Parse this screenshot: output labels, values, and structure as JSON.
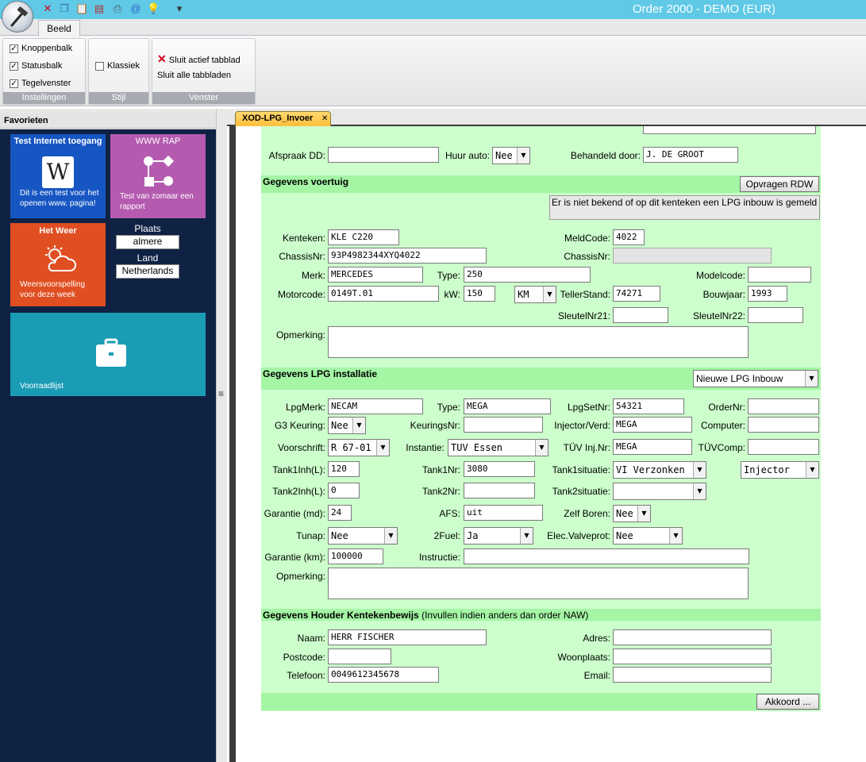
{
  "window": {
    "title": "Order 2000 - DEMO (EUR)"
  },
  "quick_access": [
    {
      "icon": "close-icon",
      "glyph": "✕",
      "color": "#d0021b"
    },
    {
      "icon": "copy-icon",
      "glyph": "❐",
      "color": "#3b6fb5"
    },
    {
      "icon": "paste-icon",
      "glyph": "📋",
      "color": "#3b6fb5"
    },
    {
      "icon": "pdf-icon",
      "glyph": "▤",
      "color": "#b03030"
    },
    {
      "icon": "print-icon",
      "glyph": "⎙",
      "color": "#555555"
    },
    {
      "icon": "email-icon",
      "glyph": "@",
      "color": "#2a62c9"
    },
    {
      "icon": "lightbulb-icon",
      "glyph": "💡",
      "color": "#e0a800"
    },
    {
      "icon": "customize-arrow-icon",
      "glyph": "▾",
      "color": "#333333"
    }
  ],
  "ribbon": {
    "tab": "Beeld",
    "groups": {
      "instellingen": {
        "label": "Instellingen",
        "items": [
          {
            "label": "Knoppenbalk",
            "checked": true
          },
          {
            "label": "Statusbalk",
            "checked": true
          },
          {
            "label": "Tegelvenster",
            "checked": true
          }
        ]
      },
      "stijl": {
        "label": "Stijl",
        "items": [
          {
            "label": "Klassiek",
            "checked": false
          }
        ]
      },
      "venster": {
        "label": "Venster",
        "close_active": "Sluit actief tabblad",
        "close_all": "Sluit alle tabbladen"
      }
    }
  },
  "favorites": {
    "header": "Favorieten",
    "tiles": {
      "internet": {
        "title": "Test Internet toegang",
        "desc": "Dit is een test voor het openen www. pagina!",
        "color": "#1656c2"
      },
      "rap": {
        "title": "WWW RAP",
        "desc": "Test van zomaar een rapport",
        "color": "#b45bb0"
      },
      "weer": {
        "title": "Het Weer",
        "desc": "Weersvoorspelling voor deze week",
        "color": "#e04f22"
      },
      "voorraad": {
        "title": "Voorraadlijst",
        "color": "#1a9cb5"
      }
    },
    "plaats_label": "Plaats",
    "plaats_value": "almere",
    "land_label": "Land",
    "land_value": "Netherlands"
  },
  "doc_tab": {
    "label": "XOD-LPG_Invoer"
  },
  "form": {
    "afspraak_label": "Afspraak DD:",
    "afspraak": "",
    "huurauto_label": "Huur auto:",
    "huurauto": "Nee",
    "behandeld_label": "Behandeld door:",
    "behandeld": "J. DE GROOT",
    "voertuig": {
      "title": "Gegevens voertuig",
      "rdw_button": "Opvragen RDW",
      "notice": "Er is niet bekend of op dit kenteken een LPG inbouw is gemeld",
      "kenteken_label": "Kenteken:",
      "kenteken": "KLE C220",
      "meldcode_label": "MeldCode:",
      "meldcode": "4022",
      "chassis_label": "ChassisNr:",
      "chassis": "93P4982344XYQ4022",
      "chassis2_label": "ChassisNr:",
      "chassis2": "",
      "merk_label": "Merk:",
      "merk": "MERCEDES",
      "type_label": "Type:",
      "type": "250",
      "modelcode_label": "Modelcode:",
      "modelcode": "",
      "motorcode_label": "Motorcode:",
      "motorcode": "0149T.01",
      "kw_label": "kW:",
      "kw": "150",
      "unit": "KM",
      "tellerstand_label": "TellerStand:",
      "tellerstand": "74271",
      "bouwjaar_label": "Bouwjaar:",
      "bouwjaar": "1993",
      "sleutel21_label": "SleutelNr21:",
      "sleutel21": "",
      "sleutel22_label": "SleutelNr22:",
      "sleutel22": "",
      "opmerking_label": "Opmerking:",
      "opmerking": ""
    },
    "lpg": {
      "title": "Gegevens LPG installatie",
      "inbouw_select": "Nieuwe LPG Inbouw",
      "lpgmerk_label": "LpgMerk:",
      "lpgmerk": "NECAM",
      "type_label": "Type:",
      "type": "MEGA",
      "lpgsetnr_label": "LpgSetNr:",
      "lpgsetnr": "54321",
      "ordernr_label": "OrderNr:",
      "ordernr": "",
      "g3_label": "G3 Keuring:",
      "g3": "Nee",
      "keurings_label": "KeuringsNr:",
      "keurings": "",
      "injector_label": "Injector/Verd:",
      "injector": "MEGA",
      "computer_label": "Computer:",
      "computer": "",
      "voorschrift_label": "Voorschrift:",
      "voorschrift": "R 67-01",
      "instantie_label": "Instantie:",
      "instantie": "TUV Essen",
      "tuvinj_label": "TÜV Inj.Nr:",
      "tuvinj": "MEGA",
      "tuvcomp_label": "TÜVComp:",
      "tuvcomp": "",
      "tank1inh_label": "Tank1Inh(L):",
      "tank1inh": "120",
      "tank1nr_label": "Tank1Nr:",
      "tank1nr": "3080",
      "tank1sit_label": "Tank1situatie:",
      "tank1sit": "VI Verzonken",
      "injector_select": "Injector",
      "tank2inh_label": "Tank2Inh(L):",
      "tank2inh": "0",
      "tank2nr_label": "Tank2Nr:",
      "tank2nr": "",
      "tank2sit_label": "Tank2situatie:",
      "tank2sit": "",
      "garantie_md_label": "Garantie (md):",
      "garantie_md": "24",
      "afs_label": "AFS:",
      "afs": "uit",
      "zelfboren_label": "Zelf Boren:",
      "zelfboren": "Nee",
      "tunap_label": "Tunap:",
      "tunap": "Nee",
      "twofuel_label": "2Fuel:",
      "twofuel": "Ja",
      "elec_label": "Elec.Valveprot:",
      "elec": "Nee",
      "garantie_km_label": "Garantie (km):",
      "garantie_km": "100000",
      "instructie_label": "Instructie:",
      "instructie": "",
      "opmerking_label": "Opmerking:",
      "opmerking": ""
    },
    "houder": {
      "title": "Gegevens Houder Kentekenbewijs",
      "subtitle": "(Invullen indien anders dan order NAW)",
      "naam_label": "Naam:",
      "naam": "HERR FISCHER",
      "adres_label": "Adres:",
      "adres": "",
      "postcode_label": "Postcode:",
      "postcode": "",
      "woonplaats_label": "Woonplaats:",
      "woonplaats": "",
      "telefoon_label": "Telefoon:",
      "telefoon": "0049612345678",
      "email_label": "Email:",
      "email": ""
    },
    "akkoord": "Akkoord ..."
  }
}
